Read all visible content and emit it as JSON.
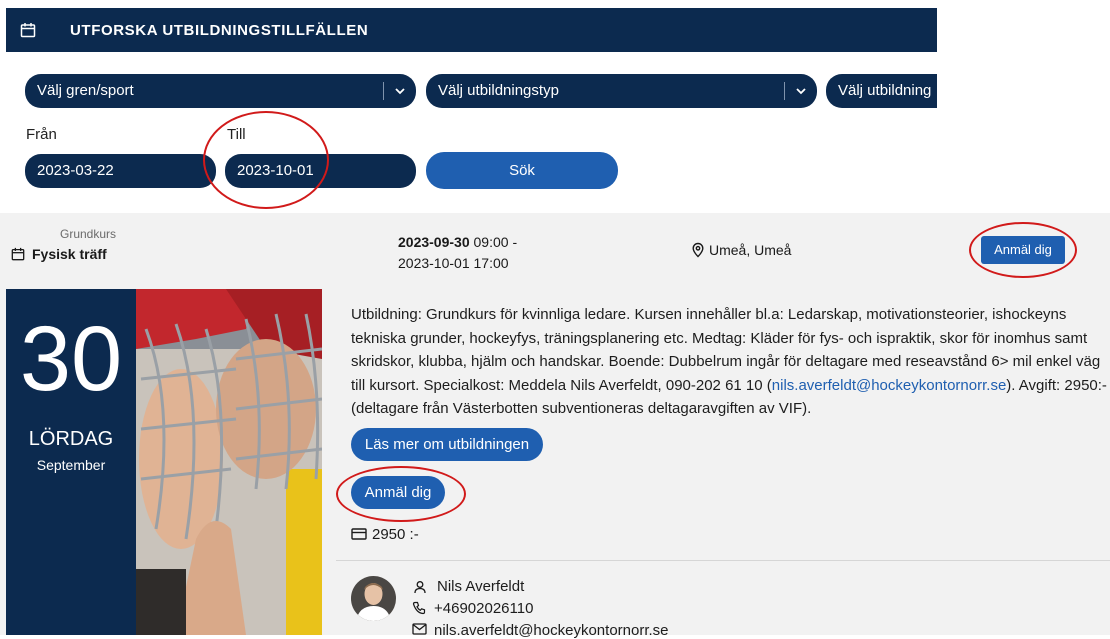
{
  "header": {
    "title": "UTFORSKA UTBILDNINGSTILLFÄLLEN",
    "icon": "calendar-icon"
  },
  "filters": {
    "sport": "Välj gren/sport",
    "type": "Välj utbildningstyp",
    "education": "Välj utbildning",
    "from_label": "Från",
    "to_label": "Till",
    "from_value": "2023-03-22",
    "to_value": "2023-10-01",
    "search_label": "Sök"
  },
  "event": {
    "category": "Grundkurs",
    "format": "Fysisk träff",
    "start_date": "2023-09-30",
    "start_time": "09:00 -",
    "end": "2023-10-01 17:00",
    "location": "Umeå, Umeå",
    "register_label": "Anmäl dig",
    "day_number": "30",
    "weekday": "LÖRDAG",
    "month": "September",
    "description_before_email": "Utbildning: Grundkurs för kvinnliga ledare. Kursen innehåller bl.a: Ledarskap, motivationsteorier, ishockeyns tekniska grunder, hockeyfys, träningsplanering etc. Medtag: Kläder för fys- och ispraktik, skor för inomhus samt skridskor, klubba, hjälm och handskar. Boende: Dubbelrum ingår för deltagare med reseavstånd 6> mil enkel väg till kursort. Specialkost: Meddela Nils Averfeldt, 090-202 61 10 (",
    "description_email": "nils.averfeldt@hockeykontornorr.se",
    "description_after_email": "). Avgift: 2950:- (deltagare från Västerbotten subventioneras deltagaravgiften av VIF).",
    "read_more_label": "Läs mer om utbildningen",
    "price": "2950 :-"
  },
  "contact": {
    "name": "Nils Averfeldt",
    "phone": "+46902026110",
    "email": "nils.averfeldt@hockeykontornorr.se"
  },
  "colors": {
    "navy": "#0c2a4f",
    "blue": "#1f5fb0",
    "annotation": "#d11a1a",
    "panel": "#f2f2f2"
  }
}
